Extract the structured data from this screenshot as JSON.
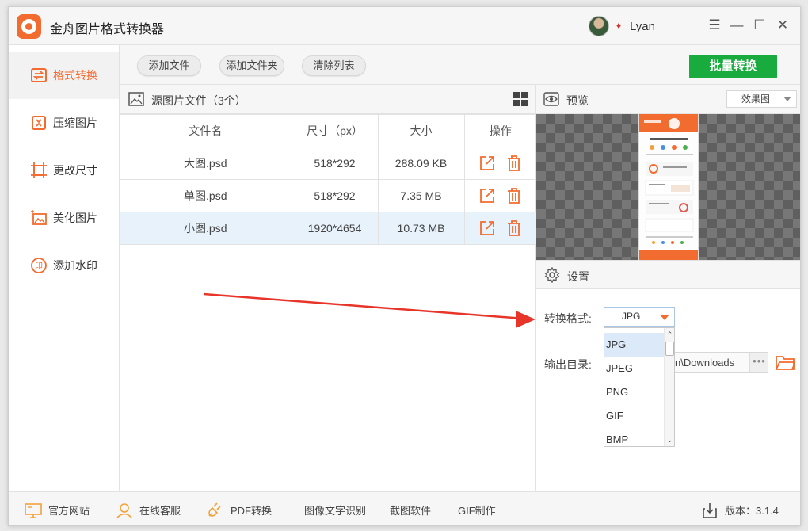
{
  "app": {
    "title": "金舟图片格式转换器",
    "username": "Lyan"
  },
  "window_controls": {
    "menu": "☰",
    "minimize": "—",
    "maximize": "☐",
    "close": "✕"
  },
  "sidebar": {
    "items": [
      {
        "label": "格式转换",
        "icon": "convert-icon",
        "active": true
      },
      {
        "label": "压缩图片",
        "icon": "compress-icon",
        "active": false
      },
      {
        "label": "更改尺寸",
        "icon": "resize-icon",
        "active": false
      },
      {
        "label": "美化图片",
        "icon": "beautify-icon",
        "active": false
      },
      {
        "label": "添加水印",
        "icon": "watermark-icon",
        "active": false
      }
    ]
  },
  "toolbar": {
    "add_file": "添加文件",
    "add_folder": "添加文件夹",
    "clear_list": "清除列表",
    "batch_convert": "批量转换"
  },
  "file_list": {
    "title": "源图片文件（3个）",
    "columns": [
      "文件名",
      "尺寸（px）",
      "大小",
      "操作"
    ],
    "rows": [
      {
        "name": "大图.psd",
        "size": "518*292",
        "filesize": "288.09 KB"
      },
      {
        "name": "单图.psd",
        "size": "518*292",
        "filesize": "7.35 MB"
      },
      {
        "name": "小图.psd",
        "size": "1920*4654",
        "filesize": "10.73 MB",
        "selected": true
      }
    ]
  },
  "preview": {
    "title": "预览",
    "mode": "效果图"
  },
  "settings": {
    "title": "设置",
    "format_label": "转换格式:",
    "format_value": "JPG",
    "format_options": [
      "JPG",
      "JPEG",
      "PNG",
      "GIF",
      "BMP"
    ],
    "output_label": "输出目录:",
    "output_value": "n\\Downloads",
    "dots": "•••"
  },
  "footer": {
    "official_site": "官方网站",
    "online_service": "在线客服",
    "pdf_convert": "PDF转换",
    "ocr": "图像文字识别",
    "screenshot": "截图软件",
    "gif": "GIF制作",
    "version": "版本：3.1.4"
  },
  "colors": {
    "accent": "#f26b2f",
    "primary_green": "#1aab3e",
    "selected_row": "#e7f2fb",
    "arrow_red": "#e8352a"
  }
}
